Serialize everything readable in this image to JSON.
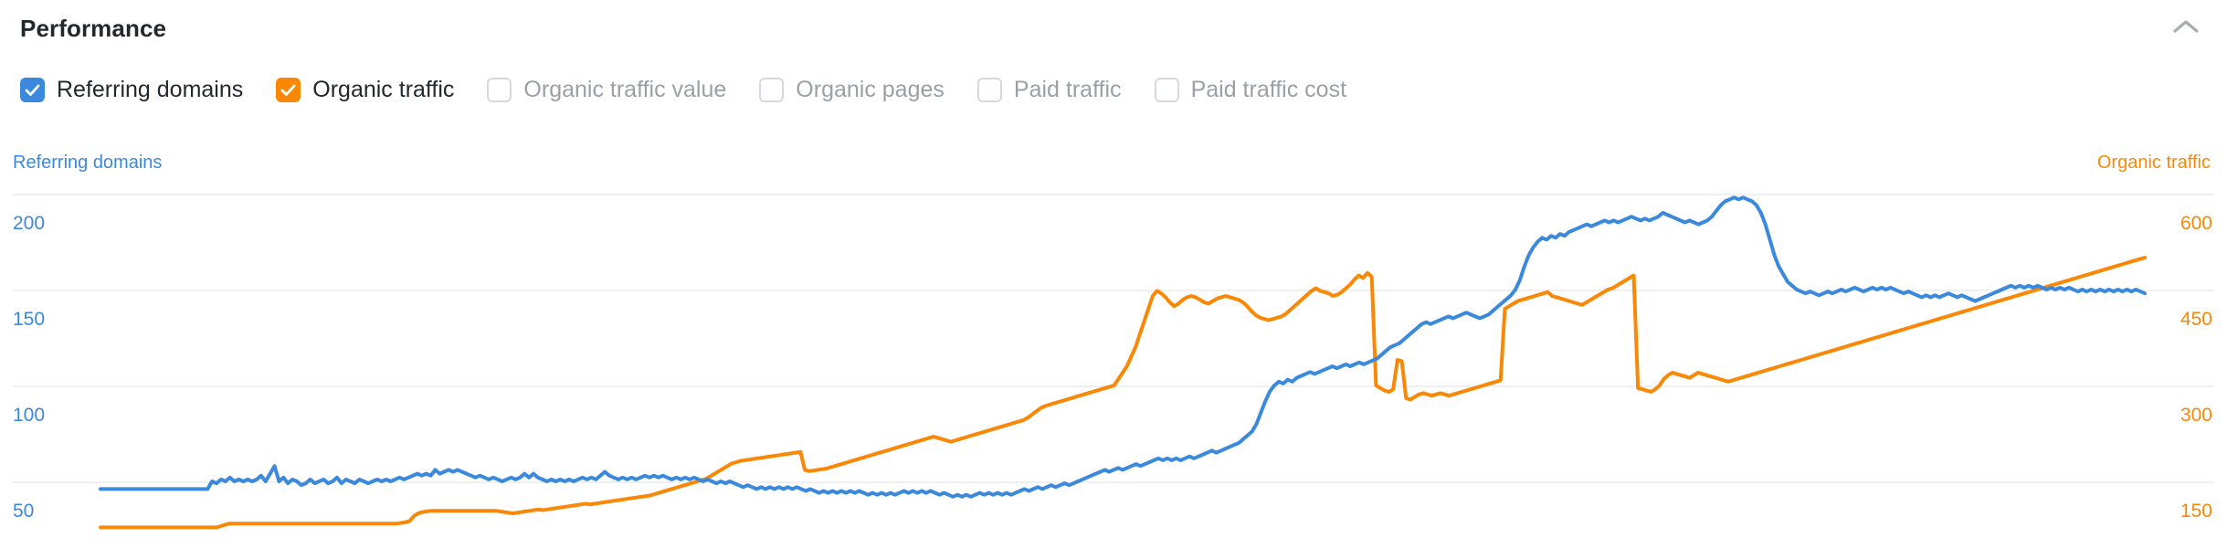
{
  "header": {
    "title": "Performance",
    "collapse_icon": "chevron-up-icon"
  },
  "legend": {
    "items": [
      {
        "label": "Referring domains",
        "checked": true,
        "color": "#3b89dd"
      },
      {
        "label": "Organic traffic",
        "checked": true,
        "color": "#f98806"
      },
      {
        "label": "Organic traffic value",
        "checked": false,
        "color": "#9aa0a6"
      },
      {
        "label": "Organic pages",
        "checked": false,
        "color": "#9aa0a6"
      },
      {
        "label": "Paid traffic",
        "checked": false,
        "color": "#9aa0a6"
      },
      {
        "label": "Paid traffic cost",
        "checked": false,
        "color": "#9aa0a6"
      }
    ]
  },
  "axes": {
    "left_title": "Referring domains",
    "right_title": "Organic traffic",
    "left_ticks": [
      "200",
      "150",
      "100",
      "50"
    ],
    "right_ticks": [
      "600",
      "450",
      "300",
      "150"
    ]
  },
  "chart_data": {
    "type": "line",
    "title": "Performance",
    "xlabel": "",
    "grid": true,
    "legend_position": "top",
    "y_left": {
      "label": "Referring domains",
      "ticks": [
        200,
        150,
        100,
        50
      ],
      "range": [
        0,
        225
      ],
      "color": "#3b89dd"
    },
    "y_right": {
      "label": "Organic traffic",
      "ticks": [
        600,
        450,
        300,
        150
      ],
      "range": [
        0,
        675
      ],
      "color": "#f98806"
    },
    "series": [
      {
        "name": "Referring domains",
        "axis": "left",
        "color": "#3b89dd",
        "values": [
          46,
          46,
          46,
          46,
          46,
          46,
          46,
          46,
          46,
          46,
          46,
          46,
          46,
          46,
          46,
          46,
          46,
          46,
          46,
          46,
          46,
          46,
          46,
          46,
          46,
          50,
          49,
          51,
          50,
          52,
          50,
          51,
          50,
          51,
          50,
          51,
          53,
          50,
          54,
          58,
          50,
          52,
          49,
          51,
          50,
          48,
          49,
          51,
          49,
          50,
          51,
          49,
          50,
          52,
          49,
          51,
          50,
          49,
          51,
          50,
          49,
          50,
          51,
          50,
          51,
          50,
          51,
          52,
          51,
          52,
          53,
          54,
          53,
          54,
          53,
          56,
          54,
          55,
          56,
          55,
          56,
          55,
          54,
          53,
          52,
          53,
          52,
          51,
          52,
          51,
          50,
          51,
          52,
          51,
          52,
          54,
          52,
          54,
          52,
          51,
          50,
          51,
          50,
          51,
          50,
          51,
          50,
          51,
          52,
          51,
          52,
          51,
          53,
          55,
          53,
          52,
          51,
          52,
          51,
          52,
          51,
          52,
          53,
          52,
          53,
          52,
          53,
          52,
          51,
          52,
          51,
          52,
          51,
          52,
          51,
          50,
          51,
          50,
          49,
          50,
          49,
          50,
          49,
          48,
          47,
          48,
          47,
          46,
          47,
          46,
          47,
          46,
          47,
          46,
          47,
          46,
          47,
          46,
          45,
          46,
          45,
          44,
          45,
          44,
          45,
          44,
          45,
          44,
          45,
          44,
          45,
          44,
          43,
          44,
          43,
          44,
          43,
          44,
          43,
          44,
          45,
          44,
          45,
          44,
          45,
          44,
          45,
          44,
          43,
          44,
          43,
          42,
          43,
          42,
          43,
          42,
          43,
          44,
          43,
          44,
          43,
          44,
          43,
          44,
          43,
          44,
          45,
          46,
          45,
          46,
          47,
          46,
          47,
          48,
          47,
          48,
          49,
          48,
          49,
          50,
          51,
          52,
          53,
          54,
          55,
          56,
          55,
          56,
          57,
          56,
          57,
          58,
          59,
          58,
          59,
          60,
          61,
          62,
          61,
          62,
          61,
          62,
          61,
          62,
          63,
          62,
          63,
          64,
          65,
          66,
          65,
          66,
          67,
          68,
          69,
          70,
          72,
          74,
          76,
          80,
          86,
          92,
          97,
          100,
          102,
          101,
          103,
          102,
          104,
          105,
          106,
          107,
          106,
          107,
          108,
          109,
          110,
          109,
          110,
          111,
          110,
          111,
          112,
          111,
          112,
          113,
          114,
          116,
          118,
          120,
          121,
          122,
          124,
          126,
          128,
          130,
          132,
          133,
          132,
          133,
          134,
          135,
          136,
          135,
          136,
          137,
          138,
          137,
          136,
          135,
          136,
          137,
          139,
          141,
          143,
          145,
          147,
          150,
          155,
          162,
          168,
          172,
          175,
          177,
          176,
          178,
          177,
          179,
          178,
          180,
          181,
          182,
          183,
          184,
          183,
          184,
          185,
          186,
          185,
          186,
          185,
          186,
          187,
          188,
          187,
          186,
          187,
          186,
          187,
          188,
          190,
          189,
          188,
          187,
          186,
          185,
          186,
          185,
          184,
          185,
          186,
          188,
          191,
          194,
          196,
          197,
          198,
          197,
          198,
          197,
          196,
          194,
          190,
          184,
          176,
          168,
          162,
          158,
          154,
          152,
          150,
          149,
          148,
          149,
          148,
          147,
          148,
          149,
          148,
          149,
          150,
          149,
          150,
          151,
          150,
          149,
          150,
          151,
          150,
          151,
          150,
          151,
          150,
          149,
          148,
          149,
          148,
          147,
          146,
          147,
          146,
          147,
          146,
          147,
          148,
          147,
          146,
          147,
          146,
          145,
          144,
          145,
          146,
          147,
          148,
          149,
          150,
          151,
          152,
          151,
          152,
          151,
          152,
          151,
          152,
          151,
          150,
          151,
          150,
          151,
          150,
          151,
          150,
          149,
          150,
          149,
          150,
          149,
          150,
          149,
          150,
          149,
          150,
          149,
          150,
          149,
          150,
          149,
          148
        ]
      },
      {
        "name": "Organic traffic",
        "axis": "right",
        "color": "#f98806",
        "values": [
          78,
          78,
          78,
          78,
          78,
          78,
          78,
          78,
          78,
          78,
          78,
          78,
          78,
          78,
          78,
          78,
          78,
          78,
          78,
          78,
          78,
          78,
          78,
          78,
          78,
          78,
          78,
          78,
          80,
          82,
          84,
          84,
          84,
          84,
          84,
          84,
          84,
          84,
          84,
          84,
          84,
          84,
          84,
          84,
          84,
          84,
          84,
          84,
          84,
          84,
          84,
          84,
          84,
          84,
          84,
          84,
          84,
          84,
          84,
          84,
          84,
          84,
          84,
          84,
          84,
          84,
          84,
          84,
          84,
          84,
          85,
          86,
          88,
          96,
          100,
          102,
          103,
          104,
          104,
          104,
          104,
          104,
          104,
          104,
          104,
          104,
          104,
          104,
          104,
          104,
          104,
          104,
          104,
          103,
          102,
          101,
          100,
          101,
          102,
          103,
          104,
          105,
          106,
          105,
          106,
          107,
          108,
          109,
          110,
          111,
          112,
          113,
          114,
          115,
          114,
          115,
          116,
          117,
          118,
          119,
          120,
          121,
          122,
          123,
          124,
          125,
          126,
          127,
          128,
          130,
          132,
          134,
          136,
          138,
          140,
          142,
          144,
          146,
          148,
          150,
          152,
          154,
          158,
          162,
          166,
          170,
          174,
          178,
          180,
          182,
          183,
          184,
          185,
          186,
          187,
          188,
          189,
          190,
          191,
          192,
          193,
          194,
          195,
          196,
          168,
          166,
          167,
          168,
          169,
          170,
          172,
          174,
          176,
          178,
          180,
          182,
          184,
          186,
          188,
          190,
          192,
          194,
          196,
          198,
          200,
          202,
          204,
          206,
          208,
          210,
          212,
          214,
          216,
          218,
          220,
          218,
          216,
          214,
          212,
          214,
          216,
          218,
          220,
          222,
          224,
          226,
          228,
          230,
          232,
          234,
          236,
          238,
          240,
          242,
          244,
          246,
          250,
          255,
          260,
          265,
          268,
          270,
          272,
          274,
          276,
          278,
          280,
          282,
          284,
          286,
          288,
          290,
          292,
          294,
          296,
          298,
          300,
          310,
          320,
          330,
          345,
          360,
          380,
          400,
          420,
          440,
          448,
          444,
          438,
          430,
          424,
          428,
          434,
          438,
          440,
          438,
          434,
          430,
          428,
          432,
          436,
          438,
          440,
          438,
          436,
          434,
          430,
          424,
          416,
          410,
          406,
          404,
          402,
          404,
          406,
          408,
          412,
          418,
          424,
          430,
          436,
          442,
          448,
          452,
          448,
          446,
          444,
          440,
          442,
          446,
          452,
          458,
          466,
          472,
          468,
          476,
          470,
          300,
          296,
          292,
          290,
          294,
          340,
          338,
          280,
          278,
          282,
          286,
          288,
          286,
          284,
          286,
          288,
          286,
          284,
          286,
          288,
          290,
          292,
          294,
          296,
          298,
          300,
          302,
          304,
          306,
          308,
          420,
          424,
          428,
          432,
          434,
          436,
          438,
          440,
          442,
          444,
          446,
          440,
          438,
          436,
          434,
          432,
          430,
          428,
          426,
          430,
          434,
          438,
          442,
          446,
          450,
          452,
          456,
          460,
          464,
          468,
          472,
          296,
          294,
          292,
          290,
          294,
          300,
          310,
          316,
          320,
          318,
          316,
          314,
          312,
          316,
          320,
          318,
          316,
          314,
          312,
          310,
          308,
          306,
          308,
          310,
          312,
          314,
          316,
          318,
          320,
          322,
          324,
          326,
          328,
          330,
          332,
          334,
          336,
          338,
          340,
          342,
          344,
          346,
          348,
          350,
          352,
          354,
          356,
          358,
          360,
          362,
          364,
          366,
          368,
          370,
          372,
          374,
          376,
          378,
          380,
          382,
          384,
          386,
          388,
          390,
          392,
          394,
          396,
          398,
          400,
          402,
          404,
          406,
          408,
          410,
          412,
          414,
          416,
          418,
          420,
          422,
          424,
          426,
          428,
          430,
          432,
          434,
          436,
          438,
          440,
          442,
          444,
          446,
          448,
          450,
          452,
          454,
          456,
          458,
          460,
          462,
          464,
          466,
          468,
          470,
          472,
          474,
          476,
          478,
          480,
          482,
          484,
          486,
          488,
          490,
          492,
          494,
          496,
          498,
          500
        ]
      }
    ]
  }
}
